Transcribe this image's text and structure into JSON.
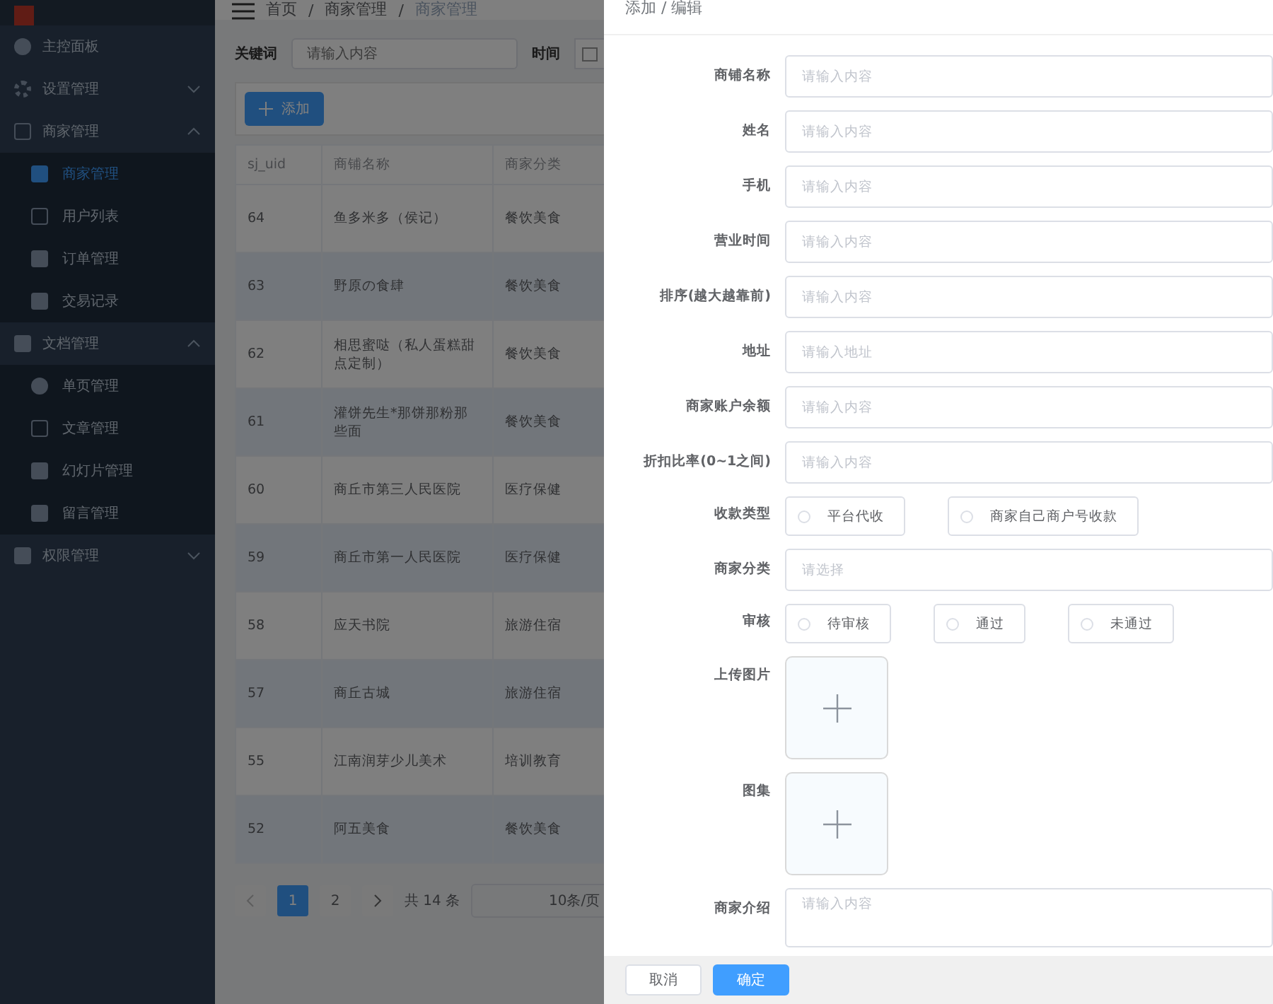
{
  "breadcrumb": {
    "separator": "/",
    "items": [
      "首页",
      "商家管理",
      "商家管理"
    ]
  },
  "sidebar": {
    "items": [
      {
        "label": "主控面板"
      },
      {
        "label": "设置管理",
        "expanded": false
      },
      {
        "label": "商家管理",
        "expanded": true,
        "children": [
          {
            "label": "商家管理",
            "selected": true
          },
          {
            "label": "用户列表",
            "selected": false
          },
          {
            "label": "订单管理",
            "selected": false
          },
          {
            "label": "交易记录",
            "selected": false
          }
        ]
      },
      {
        "label": "文档管理",
        "expanded": true,
        "children": [
          {
            "label": "单页管理",
            "selected": false
          },
          {
            "label": "文章管理",
            "selected": false
          },
          {
            "label": "幻灯片管理",
            "selected": false
          },
          {
            "label": "留言管理",
            "selected": false
          }
        ]
      },
      {
        "label": "权限管理",
        "expanded": false
      }
    ]
  },
  "filters": {
    "keyword_label": "关键词",
    "keyword_placeholder": "请输入内容",
    "time_label": "时间"
  },
  "add_button": "添加",
  "table": {
    "columns": [
      "sj_uid",
      "商铺名称",
      "商家分类"
    ],
    "rows": [
      [
        "64",
        "鱼多米多（侯记）",
        "餐饮美食"
      ],
      [
        "63",
        "野原の食肆",
        "餐饮美食"
      ],
      [
        "62",
        "相思蜜哒（私人蛋糕甜点定制）",
        "餐饮美食"
      ],
      [
        "61",
        "灌饼先生*那饼那粉那些面",
        "餐饮美食"
      ],
      [
        "60",
        "商丘市第三人民医院",
        "医疗保健"
      ],
      [
        "59",
        "商丘市第一人民医院",
        "医疗保健"
      ],
      [
        "58",
        "应天书院",
        "旅游住宿"
      ],
      [
        "57",
        "商丘古城",
        "旅游住宿"
      ],
      [
        "55",
        "江南润芽少儿美术",
        "培训教育"
      ],
      [
        "52",
        "阿五美食",
        "餐饮美食"
      ]
    ]
  },
  "pagination": {
    "pages": [
      {
        "label": "1",
        "selected": true
      },
      {
        "label": "2",
        "selected": false
      }
    ],
    "total": "共 14 条",
    "page_size": "10条/页"
  },
  "drawer": {
    "title": "添加 / 编辑",
    "fields": [
      {
        "kind": "input",
        "label": "商铺名称",
        "placeholder": "请输入内容"
      },
      {
        "kind": "input",
        "label": "姓名",
        "placeholder": "请输入内容"
      },
      {
        "kind": "input",
        "label": "手机",
        "placeholder": "请输入内容"
      },
      {
        "kind": "input",
        "label": "营业时间",
        "placeholder": "请输入内容"
      },
      {
        "kind": "input",
        "label": "排序(越大越靠前)",
        "placeholder": "请输入内容"
      },
      {
        "kind": "input",
        "label": "地址",
        "placeholder": "请输入地址"
      },
      {
        "kind": "input",
        "label": "商家账户余额",
        "placeholder": "请输入内容"
      },
      {
        "kind": "input",
        "label": "折扣比率(0~1之间)",
        "placeholder": "请输入内容"
      },
      {
        "kind": "radio",
        "label": "收款类型",
        "options": [
          {
            "label": "平台代收",
            "selected": false
          },
          {
            "label": "商家自己商户号收款",
            "selected": false
          }
        ]
      },
      {
        "kind": "select",
        "label": "商家分类",
        "placeholder": "请选择"
      },
      {
        "kind": "radio",
        "label": "审核",
        "options": [
          {
            "label": "待审核",
            "selected": false
          },
          {
            "label": "通过",
            "selected": false
          },
          {
            "label": "未通过",
            "selected": false
          }
        ]
      },
      {
        "kind": "upload",
        "label": "上传图片"
      },
      {
        "kind": "upload",
        "label": "图集"
      },
      {
        "kind": "textarea",
        "label": "商家介绍",
        "placeholder": "请输入内容"
      }
    ],
    "buttons": [
      {
        "label": "取消",
        "kind": "default"
      },
      {
        "label": "确定",
        "kind": "primary"
      }
    ]
  }
}
